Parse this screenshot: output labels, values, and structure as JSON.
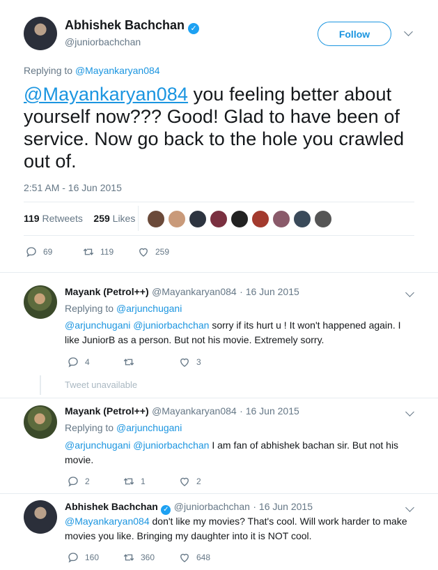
{
  "tweet": {
    "author_name": "Abhishek Bachchan",
    "handle": "@juniorbachchan",
    "follow_label": "Follow",
    "replying_prefix": "Replying to ",
    "replying_to": "@Mayankaryan084",
    "text_mention": "@Mayankaryan084",
    "text_rest": " you feeling better about yourself now??? Good! Glad to have been of service. Now go back to the hole you crawled out of.",
    "timestamp": "2:51 AM - 16 Jun 2015",
    "retweets_count": "119",
    "retweets_label": "Retweets",
    "likes_count": "259",
    "likes_label": "Likes",
    "actions": {
      "replies": "69",
      "retweets": "119",
      "likes": "259"
    }
  },
  "replies": [
    {
      "name": "Mayank (Petrol++)",
      "handle": "@Mayankaryan084",
      "date": "· 16 Jun 2015",
      "replying_prefix": "Replying to ",
      "replying_to": "@arjunchugani",
      "mentions": "@arjunchugani @juniorbachchan",
      "text": " sorry if its hurt u ! It won't happened again. I like JuniorB as a person. But not his movie. Extremely sorry.",
      "replies": "4",
      "retweets": "",
      "likes": "3"
    },
    {
      "name": "Mayank (Petrol++)",
      "handle": "@Mayankaryan084",
      "date": "· 16 Jun 2015",
      "replying_prefix": "Replying to ",
      "replying_to": "@arjunchugani",
      "mentions": "@arjunchugani @juniorbachchan",
      "text": " I am fan of abhishek bachan sir. But not his movie.",
      "replies": "2",
      "retweets": "1",
      "likes": "2"
    },
    {
      "name": "Abhishek Bachchan",
      "handle": "@juniorbachchan",
      "date": "· 16 Jun 2015",
      "mentions": "@Mayankaryan084",
      "text": " don't like my movies? That's cool. Will work harder to make movies you like. Bringing my daughter into it is NOT cool.",
      "replies": "160",
      "retweets": "360",
      "likes": "648"
    }
  ],
  "unavailable_label": "Tweet unavailable",
  "icons": {
    "verified": "verified-badge-icon",
    "reply": "reply-icon",
    "retweet": "retweet-icon",
    "like": "heart-icon",
    "more": "chevron-down-icon"
  },
  "colors": {
    "link": "#1b95e0",
    "muted": "#657786",
    "verified": "#1da1f2",
    "divider": "#e6ecf0"
  }
}
